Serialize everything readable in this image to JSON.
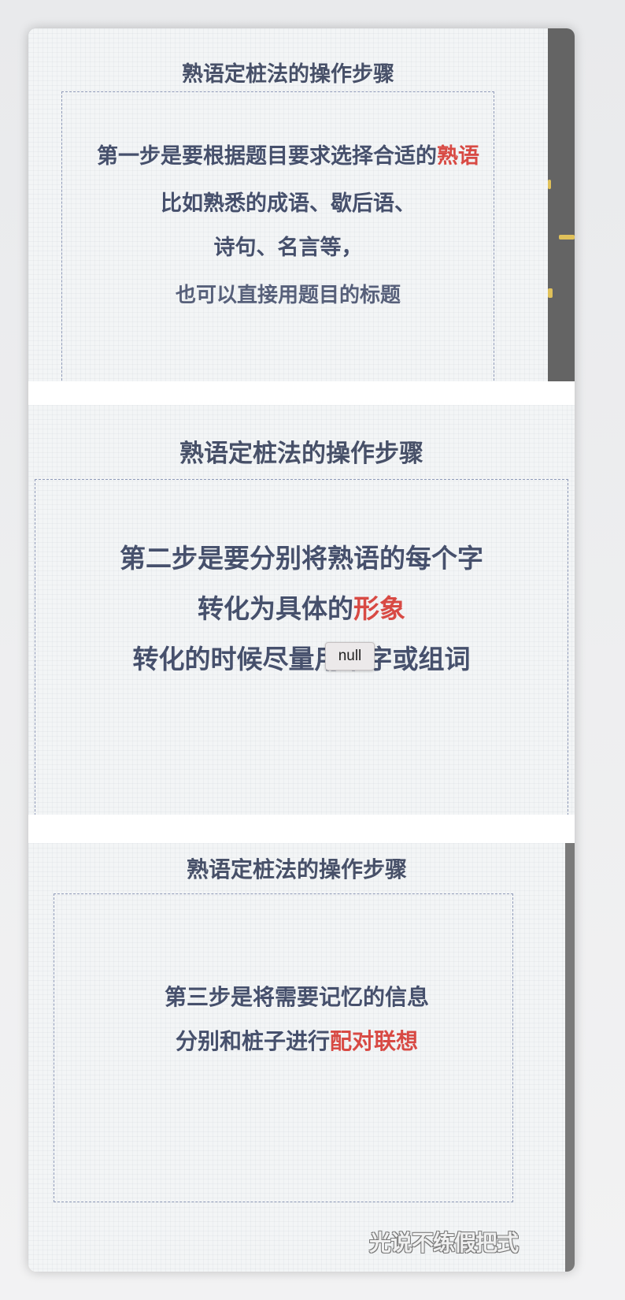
{
  "tooltip": {
    "text": "null"
  },
  "slides": [
    {
      "title": "熟语定桩法的操作步骤",
      "lines": [
        {
          "before": "第一步是要根据题目要求选择合适的",
          "highlight": "熟语",
          "after": ""
        },
        {
          "before": "比如熟悉的成语、歇后语、",
          "highlight": "",
          "after": ""
        },
        {
          "before": "诗句、名言等，",
          "highlight": "",
          "after": ""
        },
        {
          "before": "也可以直接用题目的标题",
          "highlight": "",
          "after": ""
        }
      ]
    },
    {
      "title": "熟语定桩法的操作步骤",
      "lines": [
        {
          "before": "第二步是要分别将熟语的每个字",
          "highlight": "",
          "after": ""
        },
        {
          "before": "转化为具体的",
          "highlight": "形象",
          "after": ""
        },
        {
          "before": "转化的时候尽量用本字或组词",
          "highlight": "",
          "after": ""
        }
      ]
    },
    {
      "title": "熟语定桩法的操作步骤",
      "lines": [
        {
          "before": "第三步是将需要记忆的信息",
          "highlight": "",
          "after": ""
        },
        {
          "before": "分别和桩子进行",
          "highlight": "配对联想",
          "after": ""
        }
      ],
      "watermark": "光说不练假把式"
    }
  ],
  "colors": {
    "text": "#46506c",
    "highlight": "#d84a44",
    "border": "#8f9ab8",
    "slide_bg": "#f3f5f6"
  }
}
